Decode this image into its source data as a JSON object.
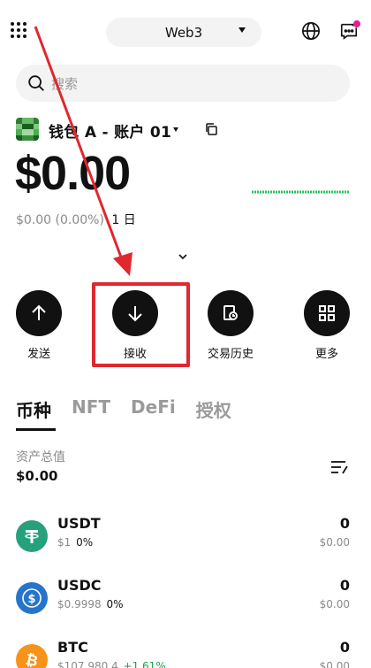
{
  "header": {
    "network_label": "Web3"
  },
  "search": {
    "placeholder": "搜索"
  },
  "wallet": {
    "name": "钱包 A - 账户 01",
    "balance": "$0.00",
    "change": "$0.00 (0.00%)",
    "period": "1 日"
  },
  "actions": [
    {
      "label": "发送",
      "icon": "arrow-up-icon"
    },
    {
      "label": "接收",
      "icon": "arrow-down-icon"
    },
    {
      "label": "交易历史",
      "icon": "history-icon"
    },
    {
      "label": "更多",
      "icon": "grid-icon"
    }
  ],
  "tabs": [
    "币种",
    "NFT",
    "DeFi",
    "授权"
  ],
  "assets_summary": {
    "label": "资产总值",
    "value": "$0.00"
  },
  "assets": [
    {
      "symbol": "USDT",
      "price": "$1",
      "change": "0%",
      "amount": "0",
      "value": "$0.00",
      "color": "#26a17b"
    },
    {
      "symbol": "USDC",
      "price": "$0.9998",
      "change": "0%",
      "amount": "0",
      "value": "$0.00",
      "color": "#2775ca"
    },
    {
      "symbol": "BTC",
      "price": "$107,980.4",
      "change": "+1.61%",
      "amount": "0",
      "value": "$0.00",
      "color": "#f7931a"
    }
  ],
  "colors": {
    "highlight": "#e0282e",
    "positive": "#1aa34a",
    "spark": "#22c55e",
    "notification_dot": "#e91e8c"
  }
}
